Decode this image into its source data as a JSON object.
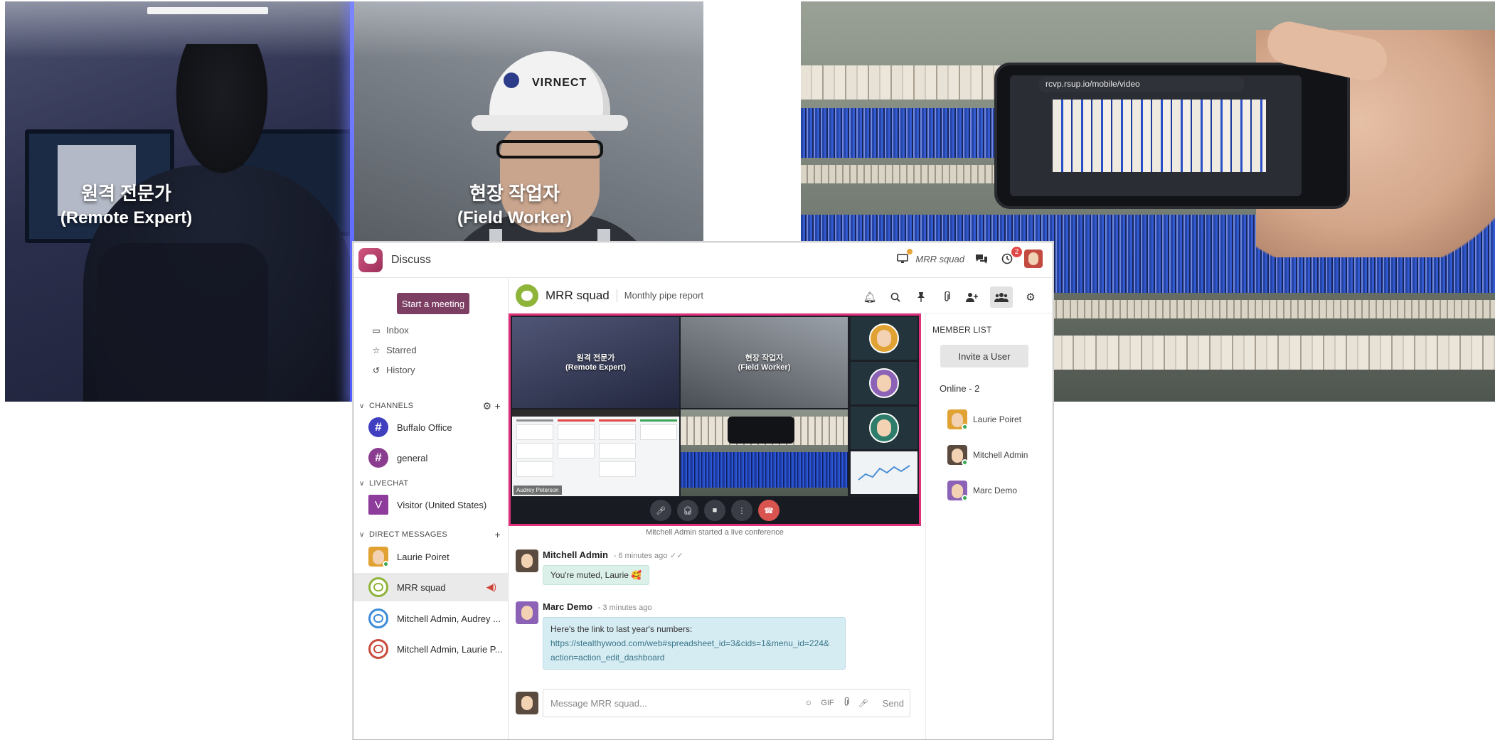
{
  "photos": {
    "expert_caption_ko": "원격 전문가",
    "expert_caption_en": "(Remote Expert)",
    "worker_caption_ko": "현장 작업자",
    "worker_caption_en": "(Field Worker)",
    "helmet_brand": "VIRNECT",
    "phone_url": "rcvp.rsup.io/mobile/video"
  },
  "app": {
    "title": "Discuss",
    "topbar": {
      "channel": "MRR squad",
      "activity_badge": "2"
    }
  },
  "sidebar": {
    "start_meeting": "Start a meeting",
    "nav": [
      {
        "label": "Inbox",
        "icon": "inbox-icon"
      },
      {
        "label": "Starred",
        "icon": "star-icon"
      },
      {
        "label": "History",
        "icon": "history-icon"
      }
    ],
    "channels_header": "CHANNELS",
    "channels": [
      {
        "label": "Buffalo Office",
        "color": "#3f3fbf"
      },
      {
        "label": "general",
        "color": "#8a3d8e"
      }
    ],
    "livechat_header": "LIVECHAT",
    "livechat": [
      {
        "label": "Visitor (United States)",
        "letter": "V"
      }
    ],
    "dm_header": "DIRECT MESSAGES",
    "dms": [
      {
        "label": "Laurie Poiret"
      },
      {
        "label": "MRR squad"
      },
      {
        "label": "Mitchell Admin, Audrey ..."
      },
      {
        "label": "Mitchell Admin, Laurie P..."
      }
    ]
  },
  "channel": {
    "name": "MRR squad",
    "description": "Monthly pipe report"
  },
  "call": {
    "tile1_ko": "원격 전문가",
    "tile1_en": "(Remote Expert)",
    "tile2_ko": "현장 작업자",
    "tile2_en": "(Field Worker)",
    "tile3_name": "Audrey Peterson"
  },
  "thread": {
    "notification": "Mitchell Admin started a live conference",
    "messages": [
      {
        "author": "Mitchell Admin",
        "time": "- 6 minutes ago",
        "body": "You're muted, Laurie 🥰"
      },
      {
        "author": "Marc Demo",
        "time": "- 3 minutes ago",
        "body_lead": "Here's the link to last year's numbers:",
        "link_line1": "https://stealthywood.com/web#spreadsheet_id=3&cids=1&menu_id=224&",
        "link_line2": "action=action_edit_dashboard"
      }
    ]
  },
  "composer": {
    "placeholder": "Message MRR squad...",
    "gif": "GIF",
    "send": "Send"
  },
  "members": {
    "title": "MEMBER LIST",
    "invite": "Invite a User",
    "online": "Online - 2",
    "list": [
      {
        "name": "Laurie Poiret"
      },
      {
        "name": "Mitchell Admin"
      },
      {
        "name": "Marc Demo"
      }
    ]
  },
  "colors": {
    "brand": "#7c3e63",
    "call_border": "#e2307c",
    "online": "#3aa655",
    "message_bubble": "#dbf0e8"
  }
}
